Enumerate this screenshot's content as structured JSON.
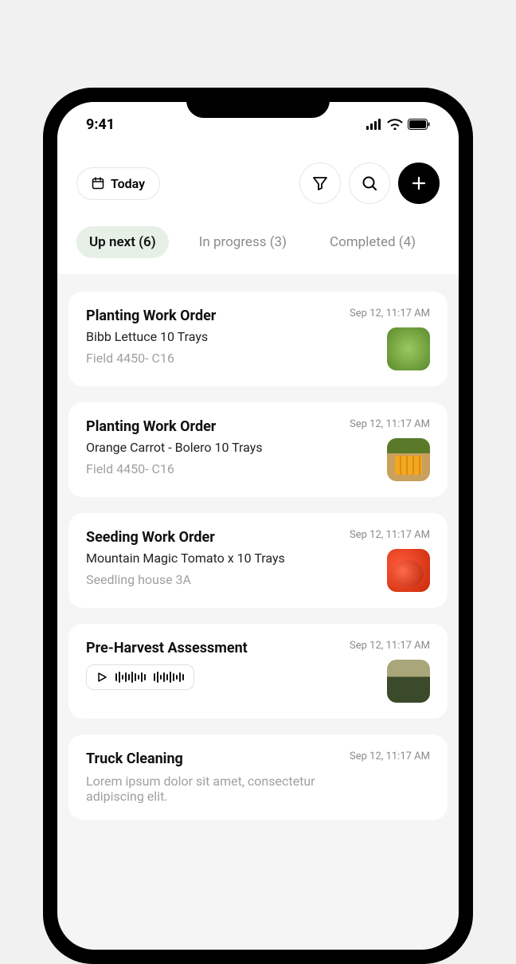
{
  "status": {
    "time": "9:41"
  },
  "header": {
    "today_label": "Today"
  },
  "tabs": [
    {
      "label": "Up next (6)",
      "active": true
    },
    {
      "label": "In progress (3)",
      "active": false
    },
    {
      "label": "Completed (4)",
      "active": false
    }
  ],
  "work_orders": [
    {
      "title": "Planting Work Order",
      "subtitle": "Bibb Lettuce 10 Trays",
      "location": "Field 4450- C16",
      "time": "Sep 12, 11:17 AM",
      "thumb": "lettuce"
    },
    {
      "title": "Planting Work Order",
      "subtitle": "Orange Carrot - Bolero 10 Trays",
      "location": "Field 4450- C16",
      "time": "Sep 12, 11:17 AM",
      "thumb": "carrot"
    },
    {
      "title": "Seeding Work Order",
      "subtitle": "Mountain Magic Tomato x 10 Trays",
      "location": "Seedling house 3A",
      "time": "Sep 12, 11:17 AM",
      "thumb": "tomato"
    },
    {
      "title": "Pre-Harvest Assessment",
      "time": "Sep 12, 11:17 AM",
      "thumb": "field",
      "audio": true
    },
    {
      "title": "Truck Cleaning",
      "subtitle": "Lorem ipsum dolor sit amet, consectetur adipiscing elit.",
      "time": "Sep 12, 11:17 AM"
    }
  ]
}
